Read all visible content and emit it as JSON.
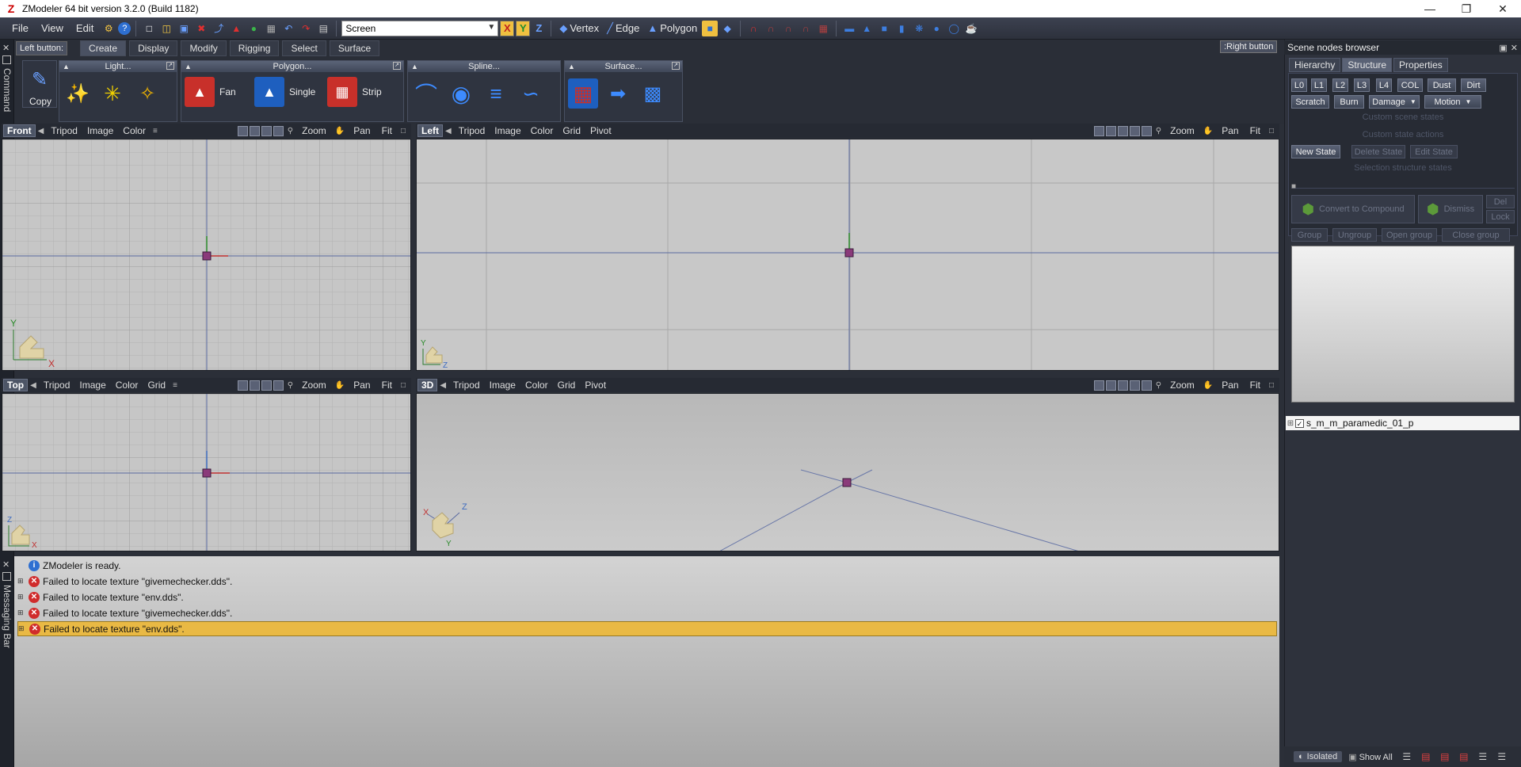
{
  "window": {
    "title": "ZModeler 64 bit version 3.2.0 (Build 1182)",
    "controls": [
      "minimize",
      "restore",
      "close"
    ]
  },
  "menu": {
    "items": [
      "File",
      "View",
      "Edit"
    ],
    "combo_value": "Screen",
    "axes": [
      "X",
      "Y",
      "Z"
    ],
    "modes": [
      "Vertex",
      "Edge",
      "Polygon"
    ]
  },
  "command_panel": {
    "side_label": "Command",
    "left_button": "Left button:",
    "right_button": ":Right button",
    "tabs": [
      "Create",
      "Display",
      "Modify",
      "Rigging",
      "Select",
      "Surface"
    ],
    "active_tab": "Create",
    "copy_label": "Copy",
    "groups": {
      "light": "Light...",
      "polygon": "Polygon...",
      "spline": "Spline...",
      "surface": "Surface..."
    },
    "polygon_tools": [
      "Fan",
      "Single",
      "Strip"
    ]
  },
  "viewports": {
    "front": {
      "name": "Front",
      "menus": [
        "Tripod",
        "Image",
        "Color"
      ]
    },
    "left": {
      "name": "Left",
      "menus": [
        "Tripod",
        "Image",
        "Color",
        "Grid",
        "Pivot"
      ]
    },
    "top": {
      "name": "Top",
      "menus": [
        "Tripod",
        "Image",
        "Color",
        "Grid"
      ]
    },
    "view3d": {
      "name": "3D",
      "menus": [
        "Tripod",
        "Image",
        "Color",
        "Grid",
        "Pivot"
      ]
    },
    "tools": [
      "Zoom",
      "Pan",
      "Fit"
    ]
  },
  "messages": {
    "side_label": "Messaging Bar",
    "rows": [
      {
        "type": "info",
        "text": "ZModeler is ready."
      },
      {
        "type": "error",
        "text": "Failed to locate texture \"givemechecker.dds\"."
      },
      {
        "type": "error",
        "text": "Failed to locate texture \"env.dds\"."
      },
      {
        "type": "error",
        "text": "Failed to locate texture \"givemechecker.dds\"."
      },
      {
        "type": "error",
        "text": "Failed to locate texture \"env.dds\"."
      }
    ]
  },
  "scene_browser": {
    "title": "Scene nodes browser",
    "tabs": [
      "Hierarchy",
      "Structure",
      "Properties"
    ],
    "active_tab": "Structure",
    "lod_buttons": [
      "L0",
      "L1",
      "L2",
      "L3",
      "L4",
      "COL",
      "Dust",
      "Dirt"
    ],
    "row2": [
      "Scratch",
      "Burn",
      "Damage",
      "Motion"
    ],
    "custom_scene_states": "Custom scene states",
    "custom_state_actions": "Custom state actions",
    "new_state": "New State",
    "delete_state": "Delete State",
    "edit_state": "Edit State",
    "selection_states": "Selection structure states",
    "convert": "Convert to Compound",
    "dismiss": "Dismiss",
    "del": "Del",
    "lock": "Lock",
    "group_buttons": [
      "Group",
      "Ungroup",
      "Open group",
      "Close group"
    ],
    "tree_item": "s_m_m_paramedic_01_p",
    "isolated": "Isolated",
    "show_all": "Show All"
  }
}
